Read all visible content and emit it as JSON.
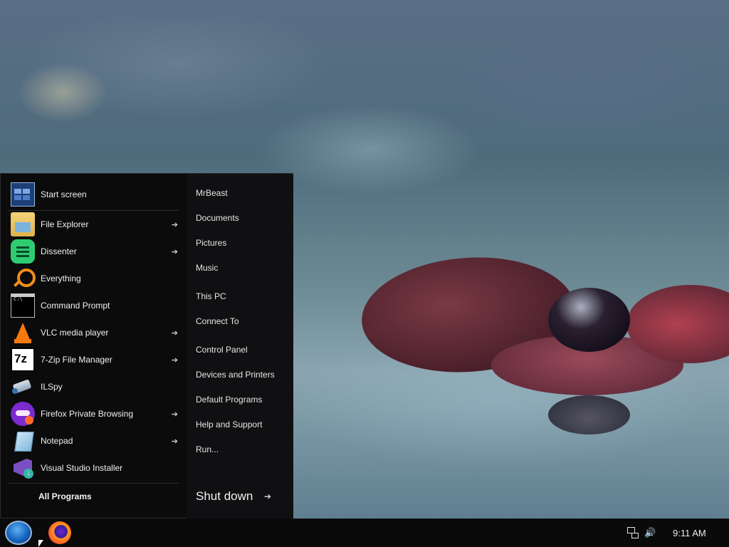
{
  "start_menu": {
    "apps": [
      {
        "label": "Start screen",
        "icon": "start-screen-icon",
        "has_submenu": false
      },
      {
        "label": "File Explorer",
        "icon": "file-explorer-icon",
        "has_submenu": true
      },
      {
        "label": "Dissenter",
        "icon": "dissenter-icon",
        "has_submenu": true
      },
      {
        "label": "Everything",
        "icon": "everything-search-icon",
        "has_submenu": false
      },
      {
        "label": "Command Prompt",
        "icon": "command-prompt-icon",
        "has_submenu": false
      },
      {
        "label": "VLC media player",
        "icon": "vlc-icon",
        "has_submenu": true
      },
      {
        "label": "7-Zip File Manager",
        "icon": "7zip-icon",
        "has_submenu": true
      },
      {
        "label": "ILSpy",
        "icon": "ilspy-icon",
        "has_submenu": false
      },
      {
        "label": "Firefox Private Browsing",
        "icon": "firefox-private-icon",
        "has_submenu": true
      },
      {
        "label": "Notepad",
        "icon": "notepad-icon",
        "has_submenu": true
      },
      {
        "label": "Visual Studio Installer",
        "icon": "visual-studio-installer-icon",
        "has_submenu": false
      }
    ],
    "submenu_arrow": "➔",
    "all_programs": "All Programs",
    "places": [
      {
        "label": "MrBeast"
      },
      {
        "label": "Documents"
      },
      {
        "label": "Pictures"
      },
      {
        "label": "Music"
      },
      {
        "label": "This PC"
      },
      {
        "label": "Connect To"
      },
      {
        "label": "Control Panel"
      },
      {
        "label": "Devices and Printers"
      },
      {
        "label": "Default Programs"
      },
      {
        "label": "Help and Support"
      },
      {
        "label": "Run..."
      }
    ],
    "shutdown_label": "Shut down",
    "shutdown_arrow": "➔"
  },
  "taskbar": {
    "pinned": [
      {
        "name": "start-orb",
        "icon": "windows-orb-icon"
      },
      {
        "name": "firefox",
        "icon": "firefox-icon"
      }
    ],
    "tray": {
      "network_icon": "network-icon",
      "volume_icon": "volume-icon",
      "volume_glyph": "🔊",
      "clock": "9:11 AM"
    }
  },
  "colors": {
    "menu_bg": "#0b0b0c",
    "taskbar_bg": "#0a0a0b",
    "text": "#f0f0f0"
  }
}
